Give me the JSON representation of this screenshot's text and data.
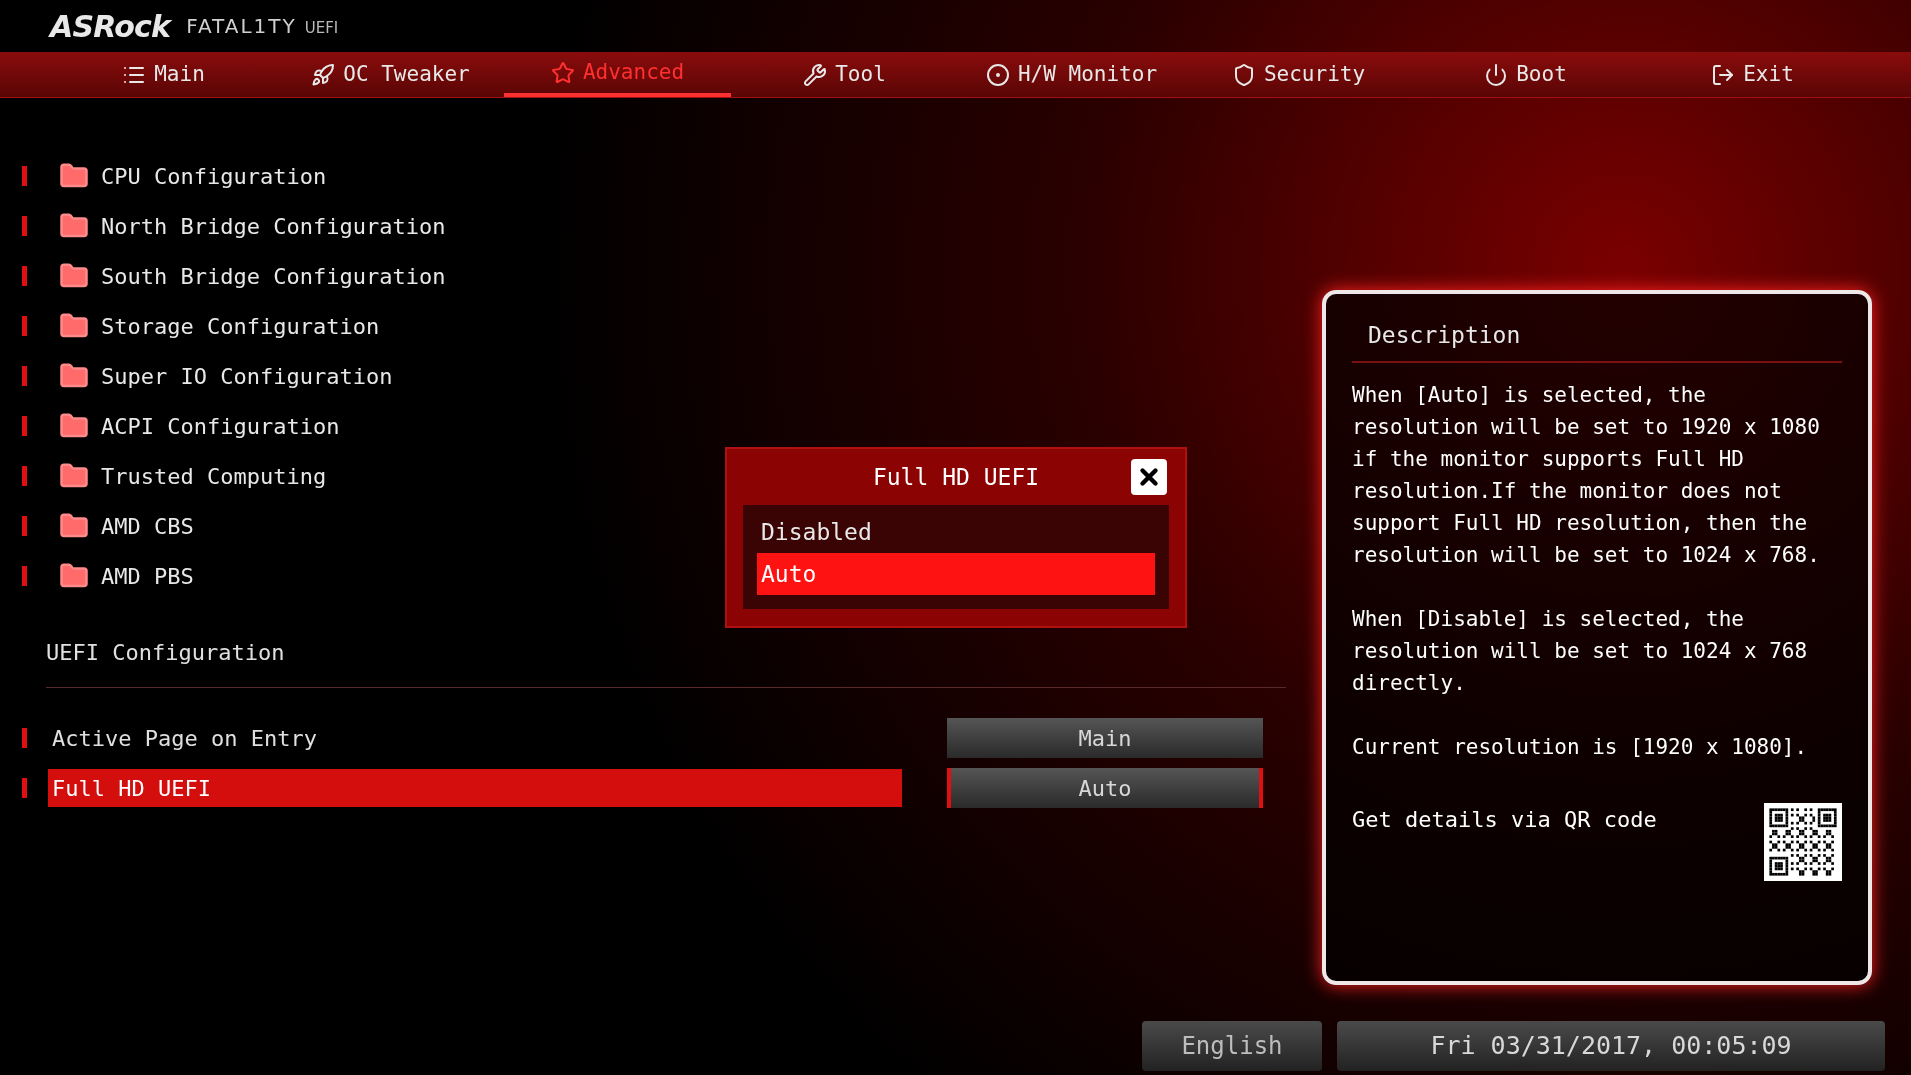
{
  "logo": {
    "brand": "ASRock",
    "series": "FATAL1TY",
    "tag": "UEFI"
  },
  "tabs": [
    {
      "label": "Main",
      "selected": false
    },
    {
      "label": "OC Tweaker",
      "selected": false
    },
    {
      "label": "Advanced",
      "selected": true
    },
    {
      "label": "Tool",
      "selected": false
    },
    {
      "label": "H/W Monitor",
      "selected": false
    },
    {
      "label": "Security",
      "selected": false
    },
    {
      "label": "Boot",
      "selected": false
    },
    {
      "label": "Exit",
      "selected": false
    }
  ],
  "menu_items": [
    "CPU Configuration",
    "North Bridge Configuration",
    "South Bridge Configuration",
    "Storage Configuration",
    "Super IO Configuration",
    "ACPI Configuration",
    "Trusted Computing",
    "AMD CBS",
    "AMD PBS"
  ],
  "settings": {
    "title": "UEFI Configuration",
    "rows": [
      {
        "label": "Active Page on Entry",
        "value": "Main",
        "selected": false
      },
      {
        "label": "Full HD UEFI",
        "value": "Auto",
        "selected": true
      }
    ]
  },
  "dialog": {
    "title": "Full HD UEFI",
    "options": [
      {
        "label": "Disabled",
        "selected": false
      },
      {
        "label": "Auto",
        "selected": true
      }
    ]
  },
  "description": {
    "title": "Description",
    "paragraphs": [
      "When [Auto] is selected, the resolution will be set to 1920 x 1080 if the monitor supports Full HD resolution.If the monitor does not support Full HD resolution, then the resolution will be set to 1024 x 768.",
      "When [Disable] is selected, the resolution will be set to 1024 x 768 directly.",
      "Current resolution is [1920 x 1080]."
    ],
    "qr_label": "Get details via QR code"
  },
  "footer": {
    "language": "English",
    "datetime": "Fri 03/31/2017, 00:05:09"
  }
}
